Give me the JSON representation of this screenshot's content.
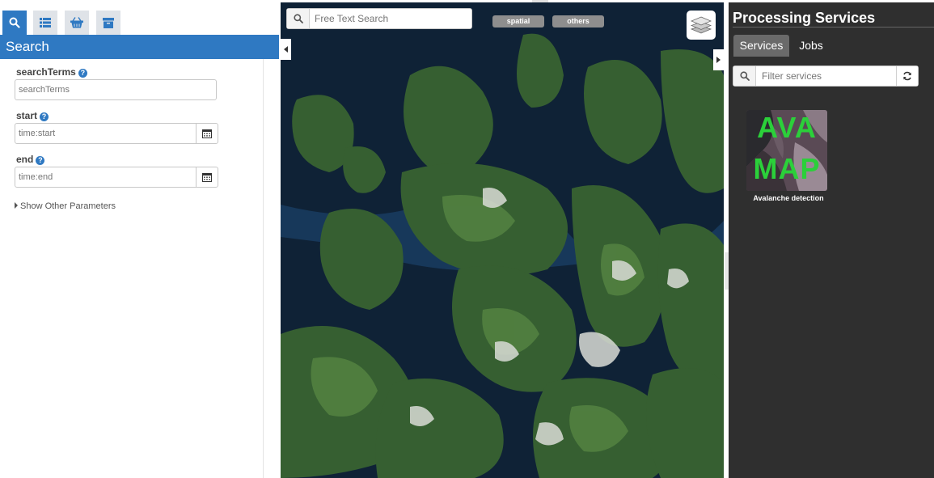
{
  "left_panel": {
    "toolbar_icons": [
      {
        "name": "search-icon",
        "active": true
      },
      {
        "name": "list-icon",
        "active": false
      },
      {
        "name": "basket-icon",
        "active": false
      },
      {
        "name": "archive-icon",
        "active": false
      }
    ],
    "header": "Search",
    "params": [
      {
        "label": "searchTerms",
        "placeholder": "searchTerms",
        "has_calendar": false
      },
      {
        "label": "start",
        "placeholder": "time:start",
        "has_calendar": true
      },
      {
        "label": "end",
        "placeholder": "time:end",
        "has_calendar": true
      }
    ],
    "help_glyph": "?",
    "show_other": "Show Other Parameters"
  },
  "map": {
    "search_placeholder": "Free Text Search",
    "filters": [
      "spatial",
      "others"
    ],
    "layers_icon": "layers-icon"
  },
  "right_panel": {
    "title": "Processing Services",
    "tabs": [
      {
        "label": "Services",
        "active": true
      },
      {
        "label": "Jobs",
        "active": false
      }
    ],
    "filter_placeholder": "Filter services",
    "services": [
      {
        "name": "Avalanche detection",
        "thumb_line1": "AVA",
        "thumb_line2": "MAP"
      }
    ]
  },
  "colors": {
    "accent": "#2f79c2",
    "dark_panel": "#2f2f2f",
    "thumb_text": "#2bd03a"
  }
}
